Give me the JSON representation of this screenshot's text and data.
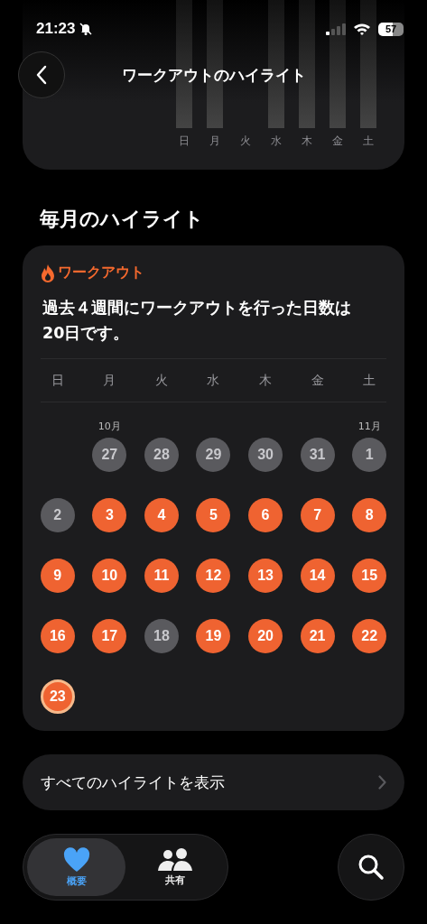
{
  "status_bar": {
    "time": "21:23",
    "battery": "57"
  },
  "nav": {
    "title": "ワークアウトのハイライト"
  },
  "weekly_chart": {
    "days": [
      {
        "label": "日",
        "bar": true
      },
      {
        "label": "月",
        "bar": true
      },
      {
        "label": "火",
        "bar": false
      },
      {
        "label": "水",
        "bar": true
      },
      {
        "label": "木",
        "bar": true
      },
      {
        "label": "金",
        "bar": true
      },
      {
        "label": "土",
        "bar": true
      }
    ]
  },
  "section_title": "毎月のハイライト",
  "highlight_card": {
    "category": "ワークアウト",
    "summary": "過去４週間にワークアウトを行った日数は20日です。",
    "weekdays": [
      "日",
      "月",
      "火",
      "水",
      "木",
      "金",
      "土"
    ],
    "weeks": [
      [
        {
          "kind": "blank"
        },
        {
          "kind": "rest",
          "day": "27",
          "month": "10月"
        },
        {
          "kind": "rest",
          "day": "28"
        },
        {
          "kind": "rest",
          "day": "29"
        },
        {
          "kind": "rest",
          "day": "30"
        },
        {
          "kind": "rest",
          "day": "31"
        },
        {
          "kind": "rest",
          "day": "1",
          "month": "11月"
        }
      ],
      [
        {
          "kind": "rest",
          "day": "2"
        },
        {
          "kind": "workout",
          "day": "3"
        },
        {
          "kind": "workout",
          "day": "4"
        },
        {
          "kind": "workout",
          "day": "5"
        },
        {
          "kind": "workout",
          "day": "6"
        },
        {
          "kind": "workout",
          "day": "7"
        },
        {
          "kind": "workout",
          "day": "8"
        }
      ],
      [
        {
          "kind": "workout",
          "day": "9"
        },
        {
          "kind": "workout",
          "day": "10"
        },
        {
          "kind": "workout",
          "day": "11"
        },
        {
          "kind": "workout",
          "day": "12"
        },
        {
          "kind": "workout",
          "day": "13"
        },
        {
          "kind": "workout",
          "day": "14"
        },
        {
          "kind": "workout",
          "day": "15"
        }
      ],
      [
        {
          "kind": "workout",
          "day": "16"
        },
        {
          "kind": "workout",
          "day": "17"
        },
        {
          "kind": "rest",
          "day": "18"
        },
        {
          "kind": "workout",
          "day": "19"
        },
        {
          "kind": "workout",
          "day": "20"
        },
        {
          "kind": "workout",
          "day": "21"
        },
        {
          "kind": "workout",
          "day": "22"
        }
      ],
      [
        {
          "kind": "today",
          "day": "23"
        }
      ]
    ]
  },
  "show_all": {
    "label": "すべてのハイライトを表示"
  },
  "tab_bar": {
    "tabs": [
      {
        "label": "概要",
        "selected": true
      },
      {
        "label": "共有",
        "selected": false
      }
    ]
  }
}
